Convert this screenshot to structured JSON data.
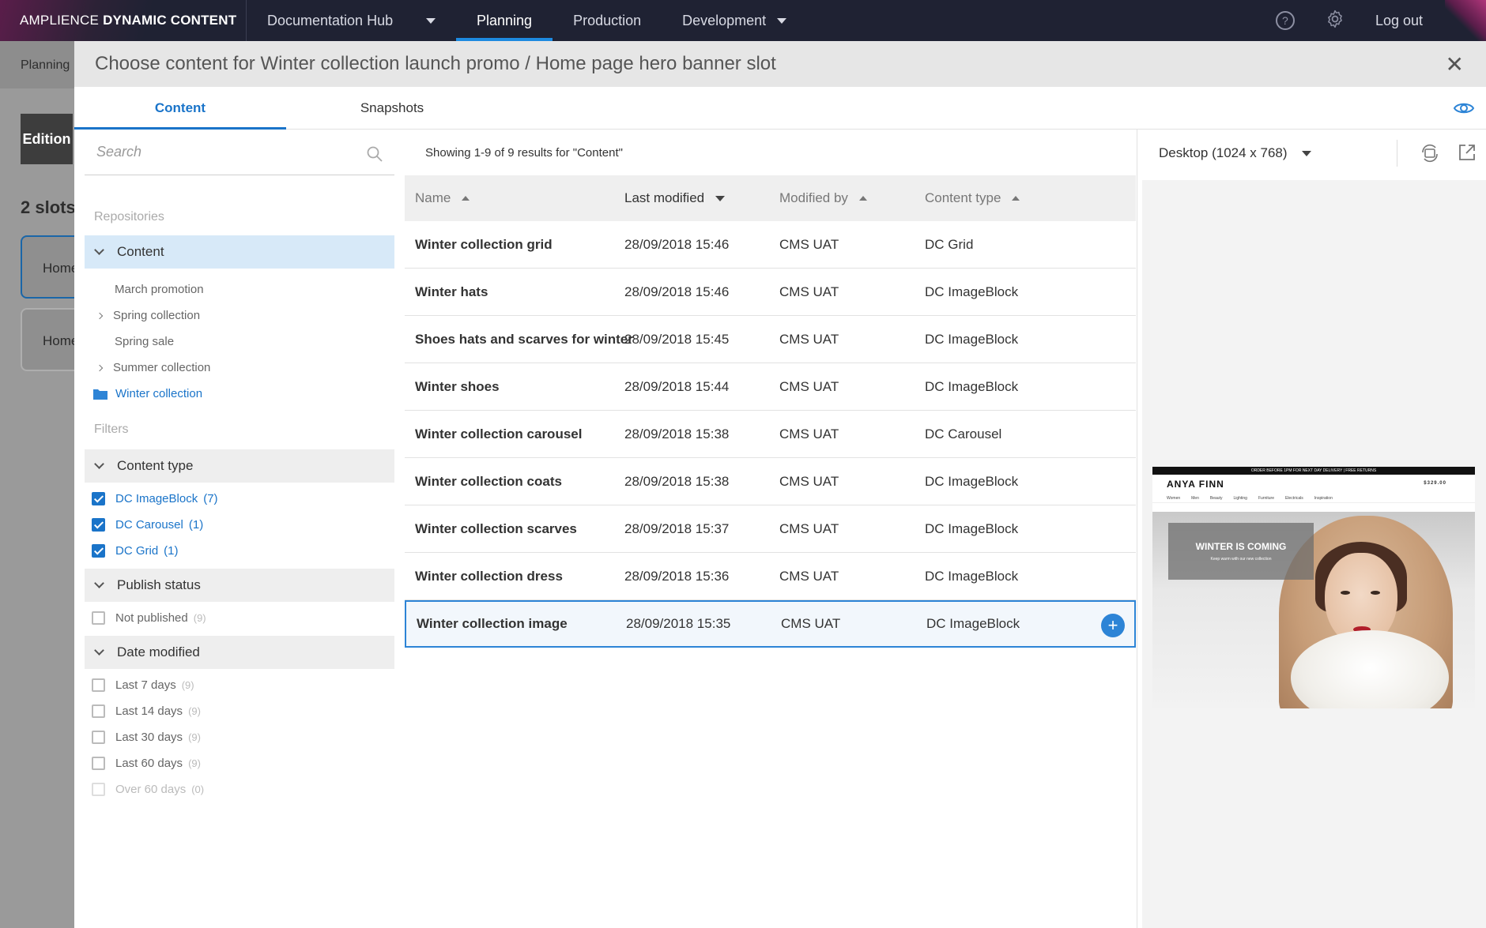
{
  "topnav": {
    "brand_light": "AMPLIENCE",
    "brand_bold": "DYNAMIC CONTENT",
    "hub": "Documentation Hub",
    "items": [
      "Planning",
      "Production",
      "Development"
    ],
    "active": "Planning",
    "help_icon": "help-icon",
    "settings_icon": "gear-icon",
    "logout": "Log out"
  },
  "background": {
    "crumb": "Planning",
    "edition": "Edition",
    "slots": "2 slots",
    "cards": [
      "Home",
      "Home"
    ]
  },
  "modal": {
    "title": "Choose content for Winter collection launch promo / Home page hero banner slot",
    "tabs": [
      "Content",
      "Snapshots"
    ],
    "active_tab": "Content"
  },
  "sidebar": {
    "search_placeholder": "Search",
    "repositories_label": "Repositories",
    "repository": "Content",
    "folders": [
      {
        "label": "March promotion",
        "has_children": false,
        "selected": false
      },
      {
        "label": "Spring collection",
        "has_children": true,
        "selected": false
      },
      {
        "label": "Spring sale",
        "has_children": false,
        "selected": false
      },
      {
        "label": "Summer collection",
        "has_children": true,
        "selected": false
      },
      {
        "label": "Winter collection",
        "has_children": false,
        "selected": true
      }
    ],
    "filters_label": "Filters",
    "content_type": {
      "label": "Content type",
      "options": [
        {
          "label": "DC ImageBlock",
          "count": "(7)",
          "checked": true
        },
        {
          "label": "DC Carousel",
          "count": "(1)",
          "checked": true
        },
        {
          "label": "DC Grid",
          "count": "(1)",
          "checked": true
        }
      ]
    },
    "publish_status": {
      "label": "Publish status",
      "options": [
        {
          "label": "Not published",
          "count": "(9)",
          "checked": false
        }
      ]
    },
    "date_modified": {
      "label": "Date modified",
      "options": [
        {
          "label": "Last 7 days",
          "count": "(9)",
          "checked": false,
          "disabled": false
        },
        {
          "label": "Last 14 days",
          "count": "(9)",
          "checked": false,
          "disabled": false
        },
        {
          "label": "Last 30 days",
          "count": "(9)",
          "checked": false,
          "disabled": false
        },
        {
          "label": "Last 60 days",
          "count": "(9)",
          "checked": false,
          "disabled": false
        },
        {
          "label": "Over 60 days",
          "count": "(0)",
          "checked": false,
          "disabled": true
        }
      ]
    }
  },
  "results": {
    "showing": "Showing 1-9 of 9 results for \"Content\"",
    "columns": [
      "Name",
      "Last modified",
      "Modified by",
      "Content type"
    ],
    "sorted_column": "Last modified",
    "rows": [
      {
        "name": "Winter collection grid",
        "modified": "28/09/2018 15:46",
        "by": "CMS UAT",
        "type": "DC Grid"
      },
      {
        "name": "Winter hats",
        "modified": "28/09/2018 15:46",
        "by": "CMS UAT",
        "type": "DC ImageBlock"
      },
      {
        "name": "Shoes hats and scarves for winter",
        "modified": "28/09/2018 15:45",
        "by": "CMS UAT",
        "type": "DC ImageBlock"
      },
      {
        "name": "Winter shoes",
        "modified": "28/09/2018 15:44",
        "by": "CMS UAT",
        "type": "DC ImageBlock"
      },
      {
        "name": "Winter collection carousel",
        "modified": "28/09/2018 15:38",
        "by": "CMS UAT",
        "type": "DC Carousel"
      },
      {
        "name": "Winter collection coats",
        "modified": "28/09/2018 15:38",
        "by": "CMS UAT",
        "type": "DC ImageBlock"
      },
      {
        "name": "Winter collection scarves",
        "modified": "28/09/2018 15:37",
        "by": "CMS UAT",
        "type": "DC ImageBlock"
      },
      {
        "name": "Winter collection dress",
        "modified": "28/09/2018 15:36",
        "by": "CMS UAT",
        "type": "DC ImageBlock"
      },
      {
        "name": "Winter collection image",
        "modified": "28/09/2018 15:35",
        "by": "CMS UAT",
        "type": "DC ImageBlock",
        "selected": true
      }
    ]
  },
  "preview": {
    "device": "Desktop (1024 x 768)",
    "site": {
      "strip": "ORDER BEFORE 1PM FOR NEXT DAY DELIVERY | FREE RETURNS",
      "logo": "ANYA FINN",
      "cart": "$329.00",
      "menu": [
        "Women",
        "Men",
        "Beauty",
        "Lighting",
        "Furniture",
        "Electricals",
        "Inspiration"
      ],
      "hero_title": "WINTER IS COMING",
      "hero_sub": "Keep warm with our new collection"
    }
  },
  "colors": {
    "accent": "#1a74c9",
    "topbar": "#1f2233",
    "selected_repo": "#d7e9f8"
  }
}
